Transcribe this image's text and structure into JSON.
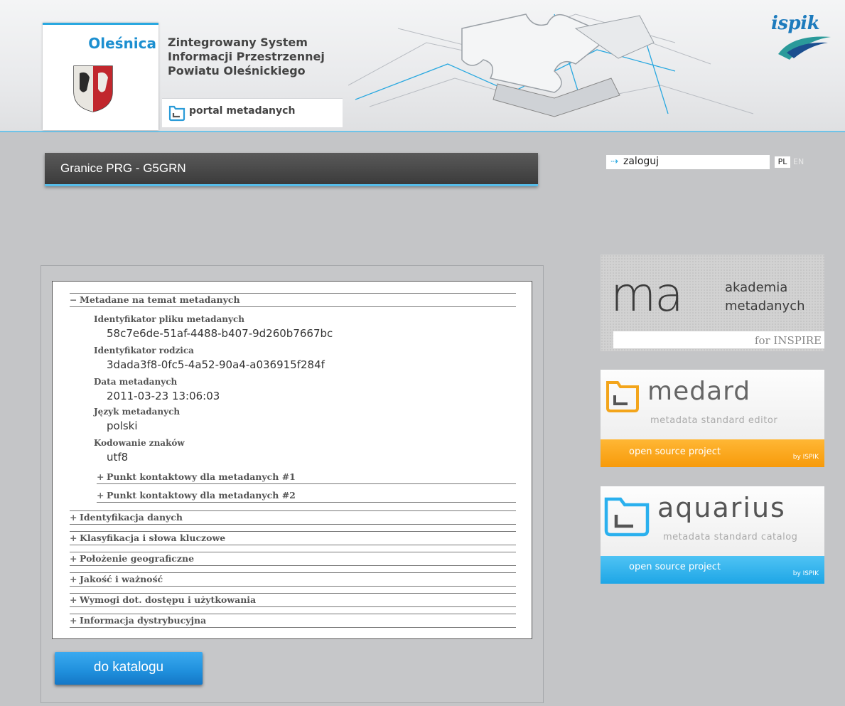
{
  "header": {
    "city": "Oleśnica",
    "title_lines": [
      "Zintegrowany System",
      "Informacji Przestrzennej",
      "Powiatu Oleśnickiego"
    ],
    "portal_label": "portal metadanych",
    "brand": "ispik"
  },
  "page": {
    "title": "Granice PRG - G5GRN"
  },
  "login": {
    "label": "zaloguj",
    "icon": "login-arrow-icon"
  },
  "languages": [
    "PL",
    "EN"
  ],
  "metadata": {
    "section_meta": {
      "symbol": "−",
      "title": "Metadane na temat metadanych"
    },
    "fields": [
      {
        "label": "Identyfikator pliku metadanych",
        "value": "58c7e6de-51af-4488-b407-9d260b7667bc"
      },
      {
        "label": "Identyfikator rodzica",
        "value": "3dada3f8-0fc5-4a52-90a4-a036915f284f"
      },
      {
        "label": "Data metadanych",
        "value": "2011-03-23 13:06:03"
      },
      {
        "label": "Język metadanych",
        "value": "polski"
      },
      {
        "label": "Kodowanie znaków",
        "value": "utf8"
      }
    ],
    "subsections": [
      {
        "symbol": "+",
        "title": "Punkt kontaktowy dla metadanych #1"
      },
      {
        "symbol": "+",
        "title": "Punkt kontaktowy dla metadanych #2"
      }
    ],
    "sections": [
      {
        "symbol": "+",
        "title": "Identyfikacja danych"
      },
      {
        "symbol": "+",
        "title": "Klasyfikacja i słowa kluczowe"
      },
      {
        "symbol": "+",
        "title": "Położenie geograficzne"
      },
      {
        "symbol": "+",
        "title": "Jakość i ważność"
      },
      {
        "symbol": "+",
        "title": "Wymogi dot. dostępu i użytkowania"
      },
      {
        "symbol": "+",
        "title": "Informacja dystrybucyjna"
      }
    ]
  },
  "catalog_button": "do katalogu",
  "banners": {
    "ma": {
      "logo": "ma",
      "line1": "akademia",
      "line2": "metadanych",
      "sub": "for INSPIRE"
    },
    "medard": {
      "name": "medard",
      "tag": "metadata standard editor",
      "oss": "open source project",
      "by": "by ISPIK",
      "color": "#f7a11a"
    },
    "aquarius": {
      "name": "aquarius",
      "tag": "metadata standard catalog",
      "oss": "open source project",
      "by": "by ISPIK",
      "color": "#2ab0ee"
    }
  },
  "colors": {
    "accent": "#29a8e0",
    "titlebar": "#444444",
    "background": "#c4c5c7"
  }
}
